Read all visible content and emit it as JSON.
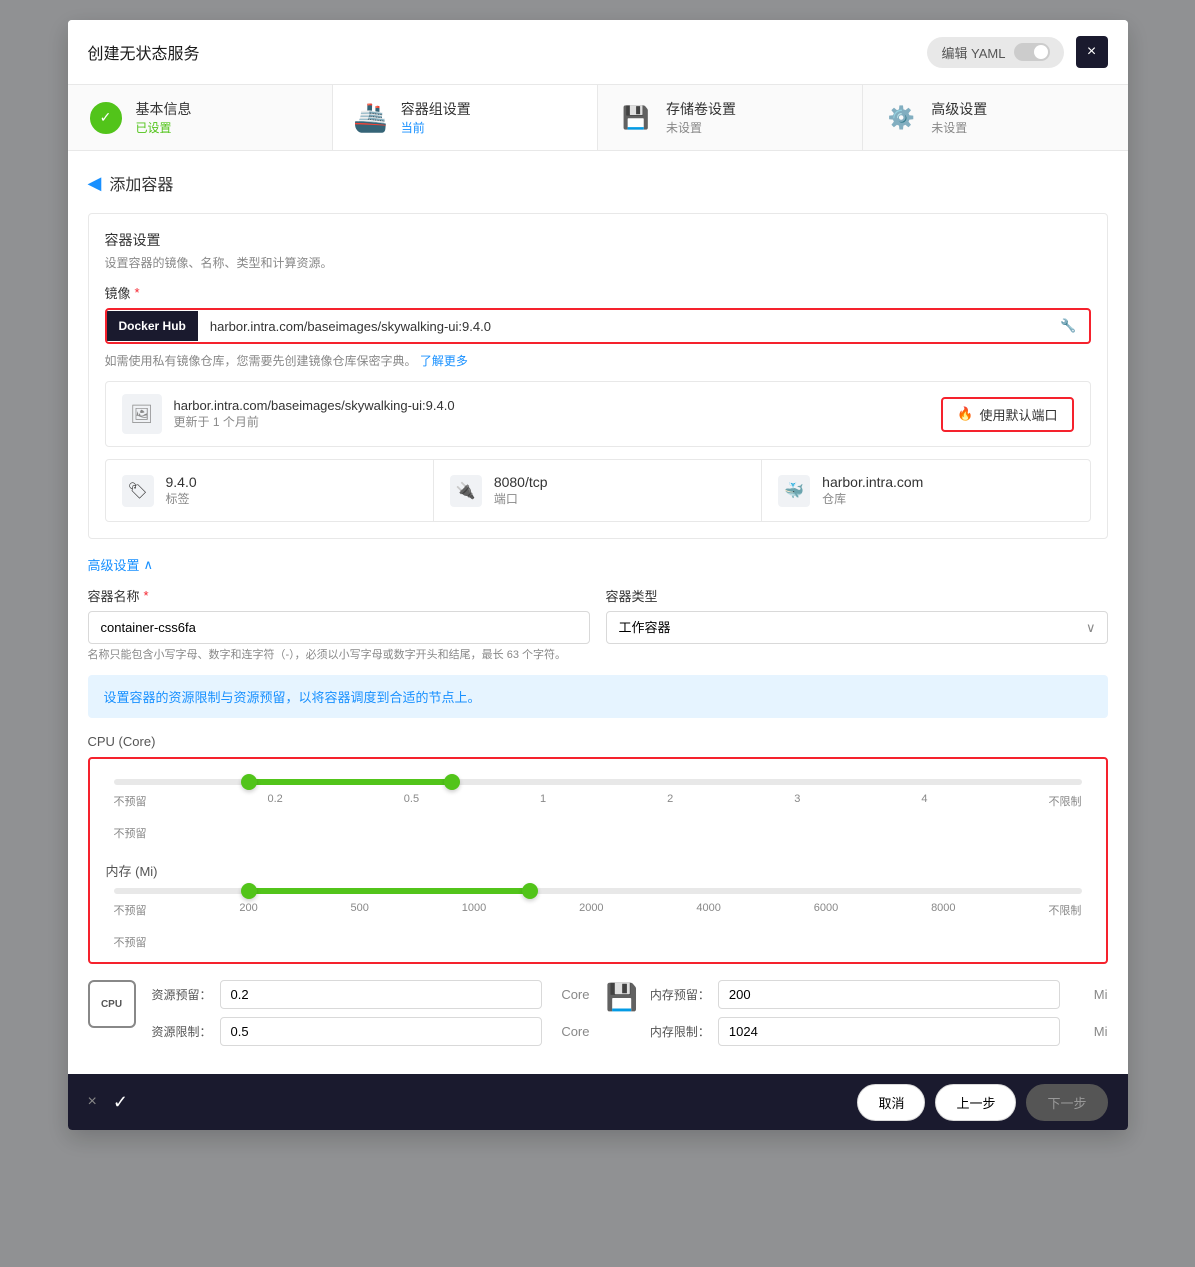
{
  "modal": {
    "title": "创建无状态服务",
    "yaml_label": "编辑 YAML",
    "close": "×"
  },
  "steps": [
    {
      "id": "basic",
      "name": "基本信息",
      "status": "已设置",
      "status_type": "done"
    },
    {
      "id": "container",
      "name": "容器组设置",
      "status": "当前",
      "status_type": "current"
    },
    {
      "id": "storage",
      "name": "存储卷设置",
      "status": "未设置",
      "status_type": "pending"
    },
    {
      "id": "advanced",
      "name": "高级设置",
      "status": "未设置",
      "status_type": "pending"
    }
  ],
  "section": {
    "title": "添加容器",
    "back_arrow": "◀"
  },
  "container_settings": {
    "title": "容器设置",
    "subtitle": "设置容器的镜像、名称、类型和计算资源。",
    "image_label": "镜像",
    "docker_hub_badge": "Docker Hub",
    "image_value": "harbor.intra.com/baseimages/skywalking-ui:9.4.0",
    "image_icon": "🔧",
    "hint_text": "如需使用私有镜像仓库，您需要先创建镜像仓库保密字典。",
    "hint_link": "了解更多",
    "preview_name": "harbor.intra.com/baseimages/skywalking-ui:9.4.0",
    "preview_time": "更新于 1 个月前",
    "use_default_btn": "使用默认端口",
    "use_default_icon": "🔥",
    "tag_value": "9.4.0",
    "tag_label": "标签",
    "port_value": "8080/tcp",
    "port_label": "端口",
    "registry_value": "harbor.intra.com",
    "registry_label": "仓库"
  },
  "advanced_settings": {
    "toggle_label": "高级设置",
    "toggle_arrow": "∧",
    "container_name_label": "容器名称",
    "container_name_required": true,
    "container_name_value": "container-css6fa",
    "container_type_label": "容器类型",
    "container_type_value": "工作容器",
    "worker_badge": "工作容器",
    "container_name_hint": "名称只能包含小写字母、数字和连字符（-），必须以小写字母或数字开头和结尾，最长 63 个字符。"
  },
  "resource_info_banner": "设置容器的资源限制与资源预留，以将容器调度到合适的节点上。",
  "cpu_section": {
    "label": "CPU (Core)",
    "no_reserve_label": "不预留",
    "tick_labels": [
      "不预留",
      "0.2",
      "0.5",
      "1",
      "2",
      "3",
      "4",
      "不限制"
    ],
    "thumb1_pct": 14,
    "thumb2_pct": 35,
    "fill_left_pct": 14,
    "fill_width_pct": 21
  },
  "memory_section": {
    "label": "内存 (Mi)",
    "no_reserve_label": "不预留",
    "tick_labels": [
      "不预留",
      "200",
      "500",
      "1000",
      "2000",
      "4000",
      "6000",
      "8000",
      "不限制"
    ],
    "thumb1_pct": 14,
    "thumb2_pct": 43,
    "fill_left_pct": 14,
    "fill_width_pct": 29
  },
  "resource_fields": {
    "cpu_reserve_label": "资源预留：",
    "cpu_reserve_value": "0.2",
    "cpu_reserve_unit": "Core",
    "cpu_limit_label": "资源限制：",
    "cpu_limit_value": "0.5",
    "cpu_limit_unit": "Core",
    "mem_reserve_label": "内存预留：",
    "mem_reserve_value": "200",
    "mem_reserve_unit": "Mi",
    "mem_limit_label": "内存限制：",
    "mem_limit_value": "1024",
    "mem_limit_unit": "Mi",
    "cpu_icon_label": "CPU"
  },
  "footer": {
    "cancel_icon": "×",
    "check_icon": "✓",
    "cancel_btn": "取消",
    "prev_btn": "上一步",
    "next_btn": "下一步"
  }
}
